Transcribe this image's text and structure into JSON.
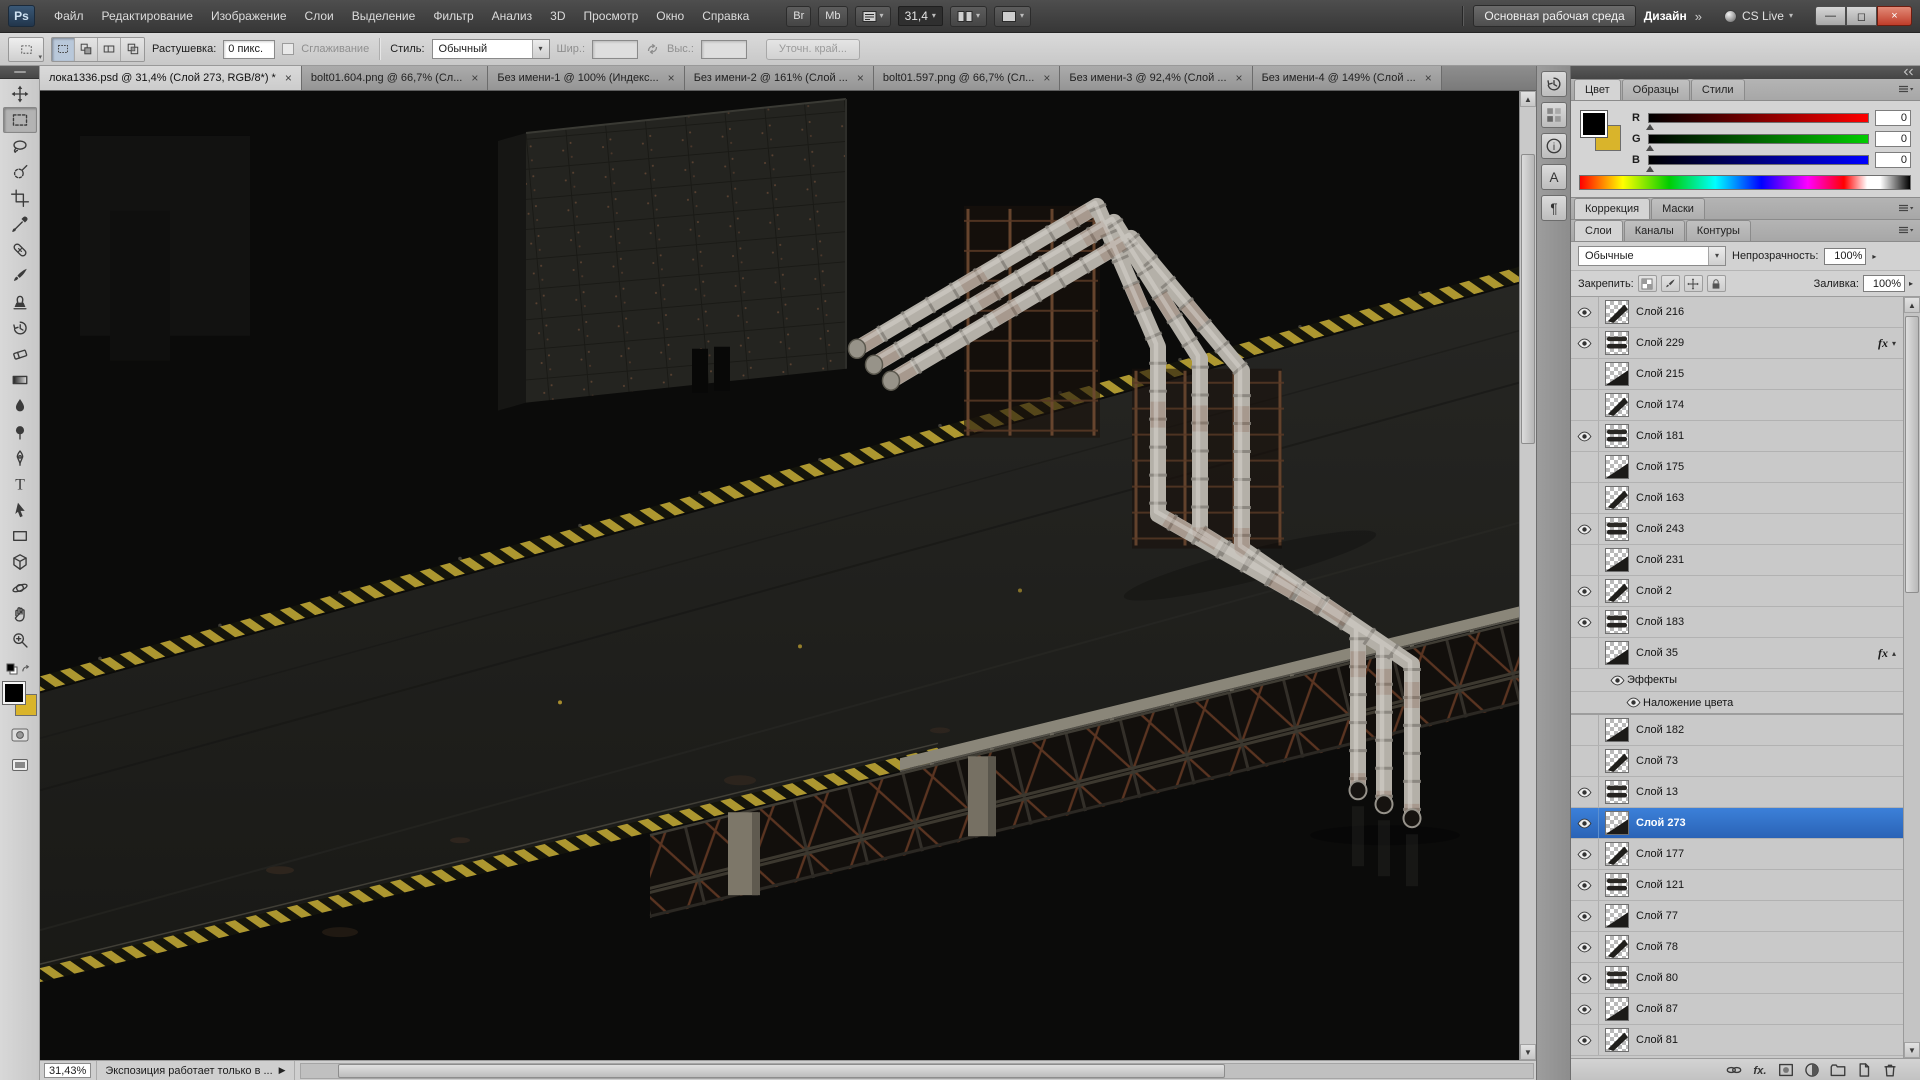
{
  "app": {
    "logo_text": "Ps",
    "menu": [
      "Файл",
      "Редактирование",
      "Изображение",
      "Слои",
      "Выделение",
      "Фильтр",
      "Анализ",
      "3D",
      "Просмотр",
      "Окно",
      "Справка"
    ],
    "appbar": {
      "bridge_label": "Br",
      "mini_bridge_label": "Mb",
      "zoom_value": "31,4",
      "workspace_primary": "Основная рабочая среда",
      "workspace_secondary": "Дизайн",
      "workspace_overflow": "»",
      "cs_live_label": "CS Live"
    },
    "window_buttons": {
      "minimize": "—",
      "restore": "◻",
      "close": "×"
    }
  },
  "options_bar": {
    "feather_label": "Растушевка:",
    "feather_value": "0 пикс.",
    "antialias_label": "Сглаживание",
    "style_label": "Стиль:",
    "style_value": "Обычный",
    "width_label": "Шир.:",
    "height_label": "Выс.:",
    "refine_edge_label": "Уточн. край..."
  },
  "document_tabs": [
    {
      "label": "лока1336.psd @ 31,4% (Слой 273, RGB/8*) *",
      "active": true
    },
    {
      "label": "bolt01.604.png @ 66,7% (Сл...",
      "active": false
    },
    {
      "label": "Без имени-1 @ 100% (Индекс...",
      "active": false
    },
    {
      "label": "Без имени-2 @ 161% (Слой ...",
      "active": false
    },
    {
      "label": "bolt01.597.png @ 66,7% (Сл...",
      "active": false
    },
    {
      "label": "Без имени-3 @ 92,4% (Слой ...",
      "active": false
    },
    {
      "label": "Без имени-4 @ 149% (Слой ...",
      "active": false
    }
  ],
  "tools": [
    {
      "id": "move-tool"
    },
    {
      "id": "rectangular-marquee-tool",
      "active": true
    },
    {
      "id": "lasso-tool"
    },
    {
      "id": "quick-selection-tool"
    },
    {
      "id": "crop-tool"
    },
    {
      "id": "eyedropper-tool"
    },
    {
      "id": "healing-brush-tool"
    },
    {
      "id": "brush-tool"
    },
    {
      "id": "clone-stamp-tool"
    },
    {
      "id": "history-brush-tool"
    },
    {
      "id": "eraser-tool"
    },
    {
      "id": "gradient-tool"
    },
    {
      "id": "blur-tool"
    },
    {
      "id": "dodge-tool"
    },
    {
      "id": "pen-tool"
    },
    {
      "id": "type-tool"
    },
    {
      "id": "path-selection-tool"
    },
    {
      "id": "rectangle-tool"
    },
    {
      "id": "3d-rotate-tool"
    },
    {
      "id": "3d-camera-tool"
    },
    {
      "id": "hand-tool"
    },
    {
      "id": "zoom-tool"
    }
  ],
  "icon_dock": [
    "history-panel-icon",
    "swatches-panel-icon",
    "info-panel-icon",
    "character-panel-icon",
    "paragraph-panel-icon"
  ],
  "color_panel": {
    "tabs": [
      "Цвет",
      "Образцы",
      "Стили"
    ],
    "active_tab": "Цвет",
    "foreground_color": "#000000",
    "background_color": "#d9b42b",
    "channels": [
      {
        "label": "R",
        "value": "0"
      },
      {
        "label": "G",
        "value": "0"
      },
      {
        "label": "B",
        "value": "0"
      }
    ]
  },
  "adjustments_panel": {
    "tabs": [
      "Коррекция",
      "Маски"
    ],
    "active_tab": "Коррекция"
  },
  "layers_panel": {
    "tabs": [
      "Слои",
      "Каналы",
      "Контуры"
    ],
    "active_tab": "Слои",
    "blend_mode": "Обычные",
    "opacity_label": "Непрозрачность:",
    "opacity_value": "100%",
    "lock_label": "Закрепить:",
    "fill_label": "Заливка:",
    "fill_value": "100%",
    "selected_layer": "Слой 273",
    "selection_color": "#2f6fc9",
    "rows": [
      {
        "name": "Слой 216",
        "visible": true
      },
      {
        "name": "Слой 229",
        "visible": true,
        "fx": true
      },
      {
        "name": "Слой 215",
        "visible": false
      },
      {
        "name": "Слой 174",
        "visible": false
      },
      {
        "name": "Слой 181",
        "visible": true
      },
      {
        "name": "Слой 175",
        "visible": false
      },
      {
        "name": "Слой 163",
        "visible": false
      },
      {
        "name": "Слой 243",
        "visible": true
      },
      {
        "name": "Слой 231",
        "visible": false
      },
      {
        "name": "Слой 2",
        "visible": true
      },
      {
        "name": "Слой 183",
        "visible": true
      },
      {
        "name": "Слой 35",
        "visible": false,
        "fx": true,
        "expanded": true
      },
      {
        "name": "Эффекты",
        "visible": true,
        "type": "effects-header"
      },
      {
        "name": "Наложение цвета",
        "visible": true,
        "type": "effect"
      },
      {
        "name": "Слой 182",
        "visible": false
      },
      {
        "name": "Слой 73",
        "visible": false
      },
      {
        "name": "Слой 13",
        "visible": true
      },
      {
        "name": "Слой 273",
        "visible": true,
        "selected": true
      },
      {
        "name": "Слой 177",
        "visible": true
      },
      {
        "name": "Слой 121",
        "visible": true
      },
      {
        "name": "Слой 77",
        "visible": true
      },
      {
        "name": "Слой 78",
        "visible": true
      },
      {
        "name": "Слой 80",
        "visible": true
      },
      {
        "name": "Слой 87",
        "visible": true
      },
      {
        "name": "Слой 81",
        "visible": true
      }
    ],
    "bottom_icons": [
      "link-layers-icon",
      "layer-style-icon",
      "add-layer-mask-icon",
      "new-adjustment-layer-icon",
      "new-group-icon",
      "new-layer-icon",
      "delete-layer-icon"
    ]
  },
  "status_bar": {
    "zoom_value": "31,43%",
    "message": "Экспозиция работает только в ..."
  }
}
